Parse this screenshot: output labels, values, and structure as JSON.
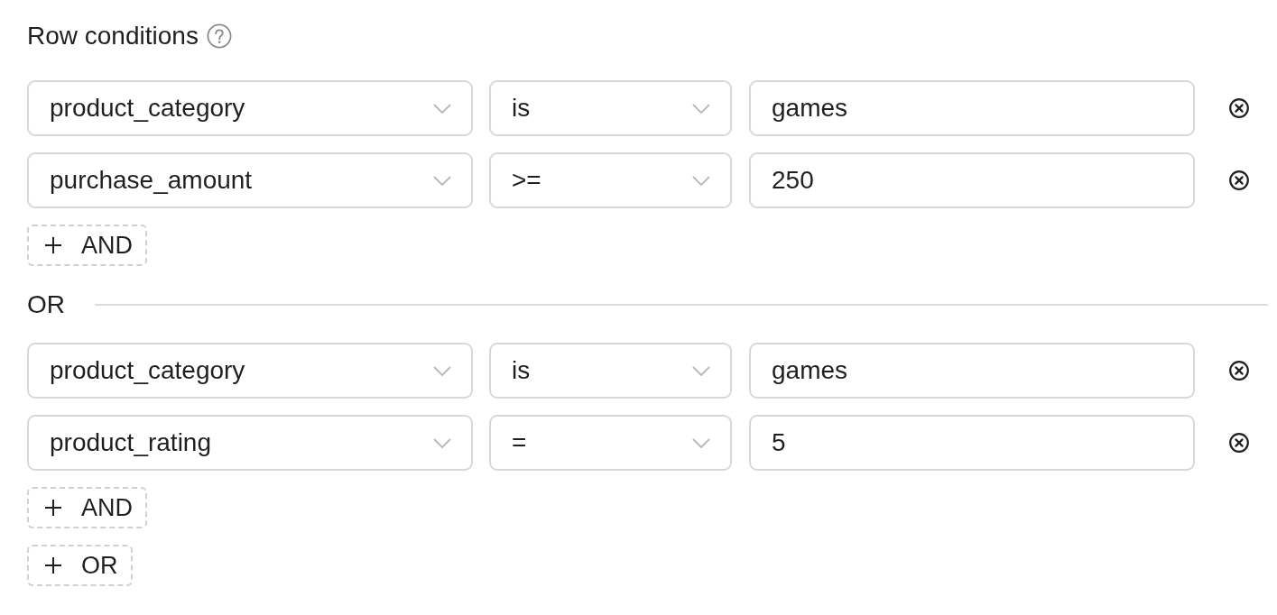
{
  "title": "Row conditions",
  "groups": [
    {
      "conditions": [
        {
          "column": "product_category",
          "operator": "is",
          "value": "games"
        },
        {
          "column": "purchase_amount",
          "operator": ">=",
          "value": "250"
        }
      ],
      "add_button": "AND"
    },
    {
      "separator": "OR",
      "conditions": [
        {
          "column": "product_category",
          "operator": "is",
          "value": "games"
        },
        {
          "column": "product_rating",
          "operator": "=",
          "value": "5"
        }
      ],
      "add_button": "AND"
    }
  ],
  "add_group_button": "OR"
}
